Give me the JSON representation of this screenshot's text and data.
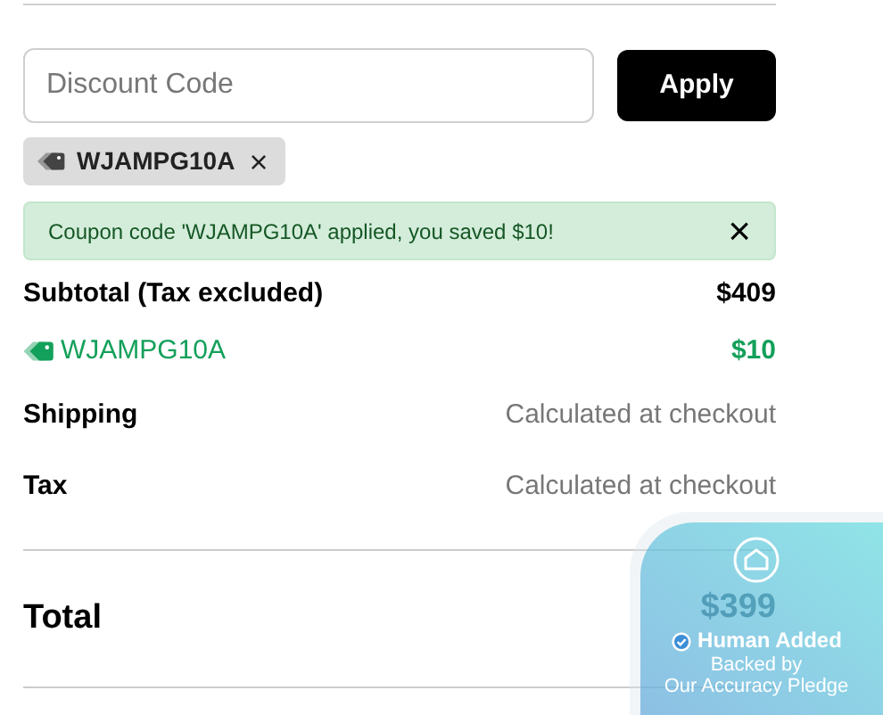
{
  "discount": {
    "placeholder": "Discount Code",
    "apply_button": "Apply"
  },
  "applied_codes": [
    {
      "code": "WJAMPG10A",
      "remove": "×"
    }
  ],
  "alert": {
    "message": "Coupon code 'WJAMPG10A' applied, you saved $10!",
    "close": "×"
  },
  "summary": [
    {
      "kind": "subtotal",
      "label": "Subtotal (Tax excluded)",
      "value": "$409"
    },
    {
      "kind": "discount",
      "label": "WJAMPG10A",
      "value": "$10"
    },
    {
      "kind": "pending",
      "label": "Shipping",
      "value": "Calculated at checkout"
    },
    {
      "kind": "pending",
      "label": "Tax",
      "value": "Calculated at checkout"
    }
  ],
  "total": {
    "label": "Total",
    "value": "$399"
  },
  "badge": {
    "title": "Human Added",
    "line_1": "Backed by",
    "line_2": "Our Accuracy Pledge"
  }
}
